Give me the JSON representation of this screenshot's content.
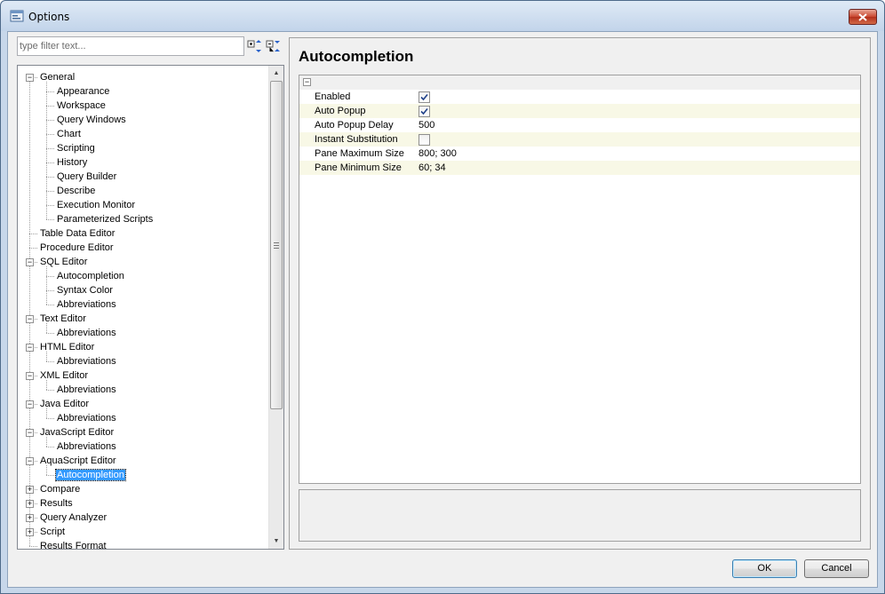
{
  "window": {
    "title": "Options"
  },
  "filter": {
    "placeholder": "type filter text..."
  },
  "tree": [
    {
      "label": "General",
      "level": 0,
      "expander": "minus"
    },
    {
      "label": "Appearance",
      "level": 1
    },
    {
      "label": "Workspace",
      "level": 1
    },
    {
      "label": "Query Windows",
      "level": 1
    },
    {
      "label": "Chart",
      "level": 1
    },
    {
      "label": "Scripting",
      "level": 1
    },
    {
      "label": "History",
      "level": 1
    },
    {
      "label": "Query Builder",
      "level": 1
    },
    {
      "label": "Describe",
      "level": 1
    },
    {
      "label": "Execution Monitor",
      "level": 1
    },
    {
      "label": "Parameterized Scripts",
      "level": 1
    },
    {
      "label": "Table Data Editor",
      "level": 0
    },
    {
      "label": "Procedure Editor",
      "level": 0
    },
    {
      "label": "SQL Editor",
      "level": 0,
      "expander": "minus"
    },
    {
      "label": "Autocompletion",
      "level": 1
    },
    {
      "label": "Syntax Color",
      "level": 1
    },
    {
      "label": "Abbreviations",
      "level": 1
    },
    {
      "label": "Text Editor",
      "level": 0,
      "expander": "minus"
    },
    {
      "label": "Abbreviations",
      "level": 1
    },
    {
      "label": "HTML Editor",
      "level": 0,
      "expander": "minus"
    },
    {
      "label": "Abbreviations",
      "level": 1
    },
    {
      "label": "XML Editor",
      "level": 0,
      "expander": "minus"
    },
    {
      "label": "Abbreviations",
      "level": 1
    },
    {
      "label": "Java Editor",
      "level": 0,
      "expander": "minus"
    },
    {
      "label": "Abbreviations",
      "level": 1
    },
    {
      "label": "JavaScript Editor",
      "level": 0,
      "expander": "minus"
    },
    {
      "label": "Abbreviations",
      "level": 1
    },
    {
      "label": "AquaScript Editor",
      "level": 0,
      "expander": "minus"
    },
    {
      "label": "Autocompletion",
      "level": 1,
      "selected": true
    },
    {
      "label": "Compare",
      "level": 0,
      "expander": "plus"
    },
    {
      "label": "Results",
      "level": 0,
      "expander": "plus"
    },
    {
      "label": "Query Analyzer",
      "level": 0,
      "expander": "plus"
    },
    {
      "label": "Script",
      "level": 0,
      "expander": "plus"
    },
    {
      "label": "Results Format",
      "level": 0
    }
  ],
  "page": {
    "title": "Autocompletion"
  },
  "properties": [
    {
      "name": "Enabled",
      "type": "checkbox",
      "checked": true
    },
    {
      "name": "Auto Popup",
      "type": "checkbox",
      "checked": true
    },
    {
      "name": "Auto Popup Delay",
      "type": "text",
      "value": "500"
    },
    {
      "name": "Instant Substitution",
      "type": "checkbox",
      "checked": false
    },
    {
      "name": "Pane Maximum Size",
      "type": "text",
      "value": "800; 300"
    },
    {
      "name": "Pane Minimum Size",
      "type": "text",
      "value": "60; 34"
    }
  ],
  "buttons": {
    "ok": "OK",
    "cancel": "Cancel"
  },
  "colors": {
    "selection": "#3399ff",
    "alt_row": "#f8f8e6",
    "close_button": "#c9472f"
  }
}
